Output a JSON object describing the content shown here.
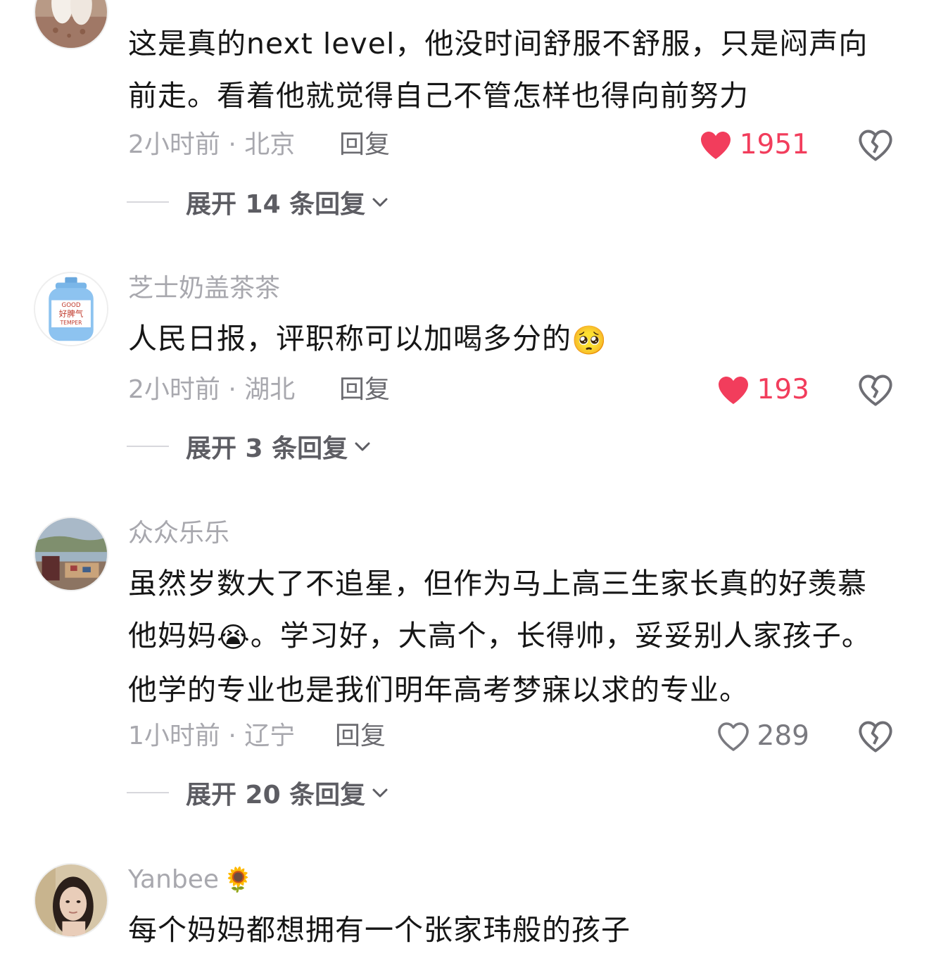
{
  "comments": [
    {
      "username": "",
      "text": "这是真的next level，他没时间舒服不舒服，只是闷声向前走。看着他就觉得自己不管怎样也得向前努力",
      "time_location": "2小时前 · 北京",
      "reply_label": "回复",
      "likes": "1951",
      "liked": true,
      "expand_label": "展开 14 条回复"
    },
    {
      "username": "芝士奶盖茶茶",
      "text": "人民日报，评职称可以加喝多分的",
      "emoji": "🥺",
      "time_location": "2小时前 · 湖北",
      "reply_label": "回复",
      "likes": "193",
      "liked": true,
      "expand_label": "展开 3 条回复",
      "avatar_text": {
        "top": "GOOD",
        "middle": "好脾气",
        "bottom": "TEMPER"
      }
    },
    {
      "username": "众众乐乐",
      "text_part1": "虽然岁数大了不追星，但作为马上高三生家长真的好羡慕他妈妈",
      "emoji": "😭",
      "text_part2": "。学习好，大高个，长得帅，妥妥别人家孩子。他学的专业也是我们明年高考梦寐以求的专业。",
      "time_location": "1小时前 · 辽宁",
      "reply_label": "回复",
      "likes": "289",
      "liked": false,
      "expand_label": "展开 20 条回复"
    },
    {
      "username": "Yanbee",
      "username_emoji": "🌻",
      "text": "每个妈妈都想拥有一个张家玮般的孩子"
    }
  ],
  "colors": {
    "like_active": "#f23d5c",
    "secondary_text": "#a8a8ae",
    "body_text": "#161616"
  },
  "icons": {
    "like": "heart-icon",
    "dislike": "broken-heart-icon",
    "expand": "chevron-down-icon"
  }
}
